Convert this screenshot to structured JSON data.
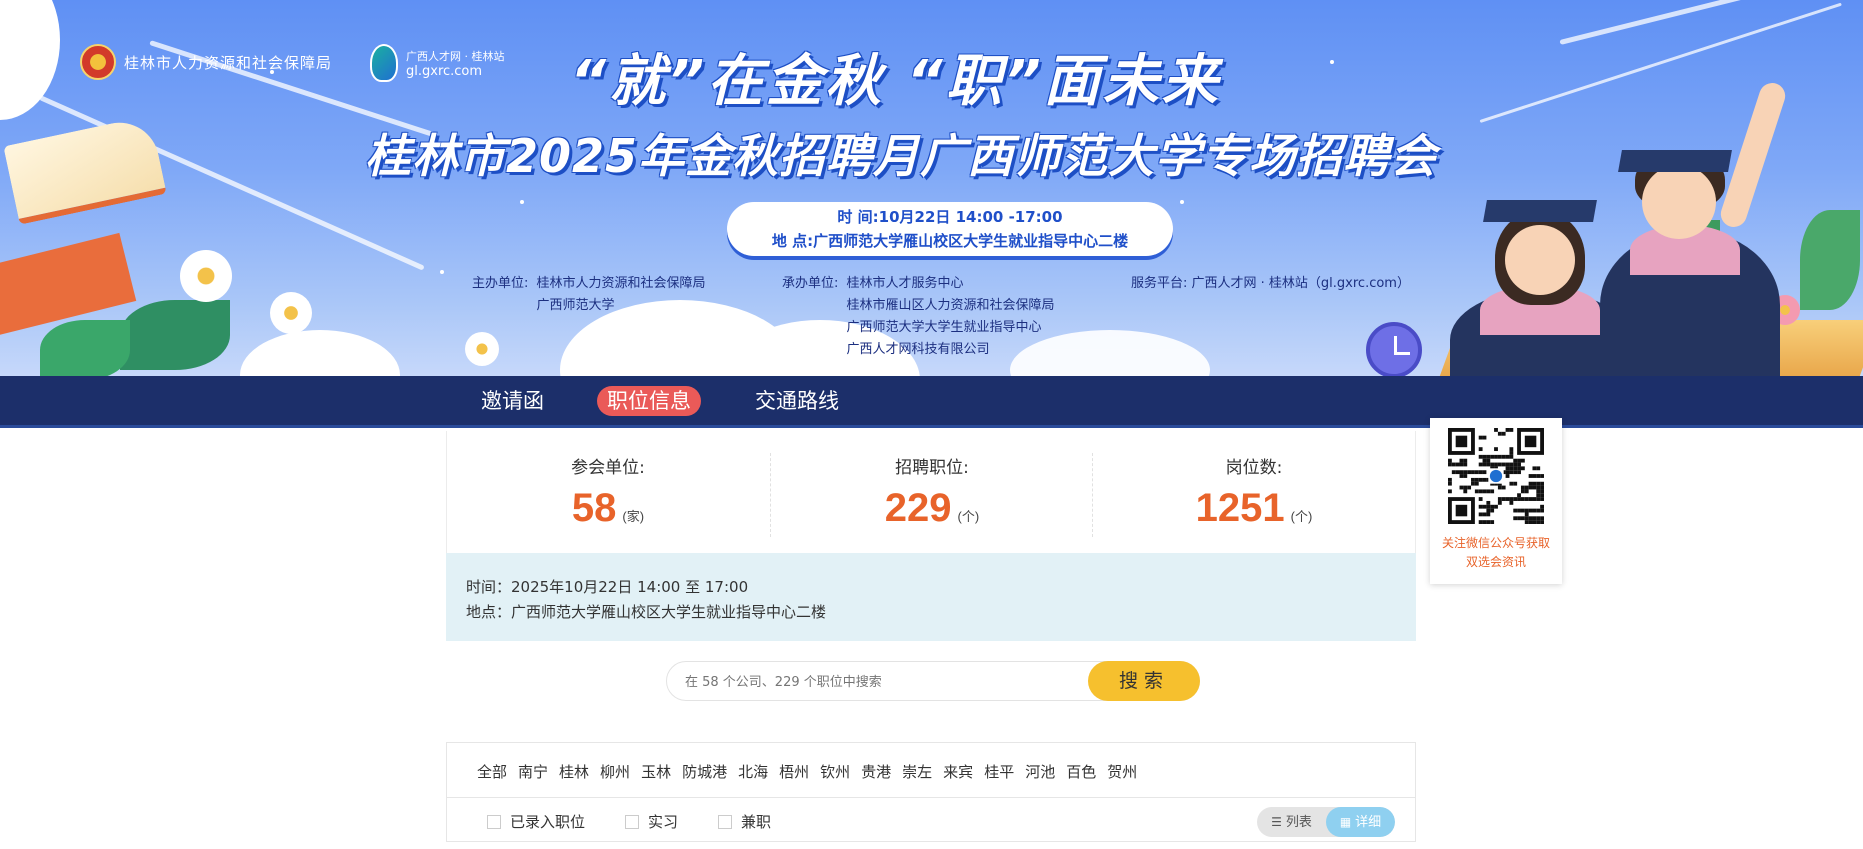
{
  "banner": {
    "org_logo_text": "桂林市人力资源和社会保障局",
    "site_logo_line1": "广西人才网 · 桂林站",
    "site_logo_line2": "gl.gxrc.com",
    "slogan": "“就”在金秋 “职”面未来",
    "title": "桂林市2025年金秋招聘月广西师范大学专场招聘会",
    "time_line": "时 间:10月22日 14:00 -17:00",
    "place_line": "地 点:广西师范大学雁山校区大学生就业指导中心二楼",
    "sponsor_label": "主办单位:",
    "sponsors": [
      "桂林市人力资源和社会保障局",
      "广西师范大学"
    ],
    "organizer_label": "承办单位:",
    "organizers": [
      "桂林市人才服务中心",
      "桂林市雁山区人力资源和社会保障局",
      "广西师范大学大学生就业指导中心",
      "广西人才网科技有限公司"
    ],
    "platform_label": "服务平台:",
    "platform": "广西人才网 · 桂林站（gl.gxrc.com）"
  },
  "nav": {
    "items": [
      {
        "label": "邀请函",
        "active": false
      },
      {
        "label": "职位信息",
        "active": true
      },
      {
        "label": "交通路线",
        "active": false
      }
    ],
    "active_color": "#ea5a58",
    "bg_color": "#1c2f6a"
  },
  "stats": [
    {
      "label": "参会单位:",
      "value": "58",
      "unit": "(家)"
    },
    {
      "label": "招聘职位:",
      "value": "229",
      "unit": "(个)"
    },
    {
      "label": "岗位数:",
      "value": "1251",
      "unit": "(个)"
    }
  ],
  "event": {
    "time": "时间：2025年10月22日 14:00 至 17:00",
    "place": "地点：广西师范大学雁山校区大学生就业指导中心二楼"
  },
  "search": {
    "placeholder": "在 58 个公司、229 个职位中搜索",
    "button": "搜索"
  },
  "regions": [
    "全部",
    "南宁",
    "桂林",
    "柳州",
    "玉林",
    "防城港",
    "北海",
    "梧州",
    "钦州",
    "贵港",
    "崇左",
    "来宾",
    "桂平",
    "河池",
    "百色",
    "贺州"
  ],
  "checkboxes": [
    "已录入职位",
    "实习",
    "兼职"
  ],
  "view_toggle": {
    "list_label": "列表",
    "list_icon": "list-icon",
    "detail_label": "详细",
    "detail_icon": "grid-icon",
    "active": "detail"
  },
  "qr": {
    "caption_line1": "关注微信公众号获取",
    "caption_line2": "双选会资讯"
  },
  "colors": {
    "accent_orange": "#e8632a",
    "search_button": "#f6c02e",
    "info_bg": "#e2f1f6"
  }
}
